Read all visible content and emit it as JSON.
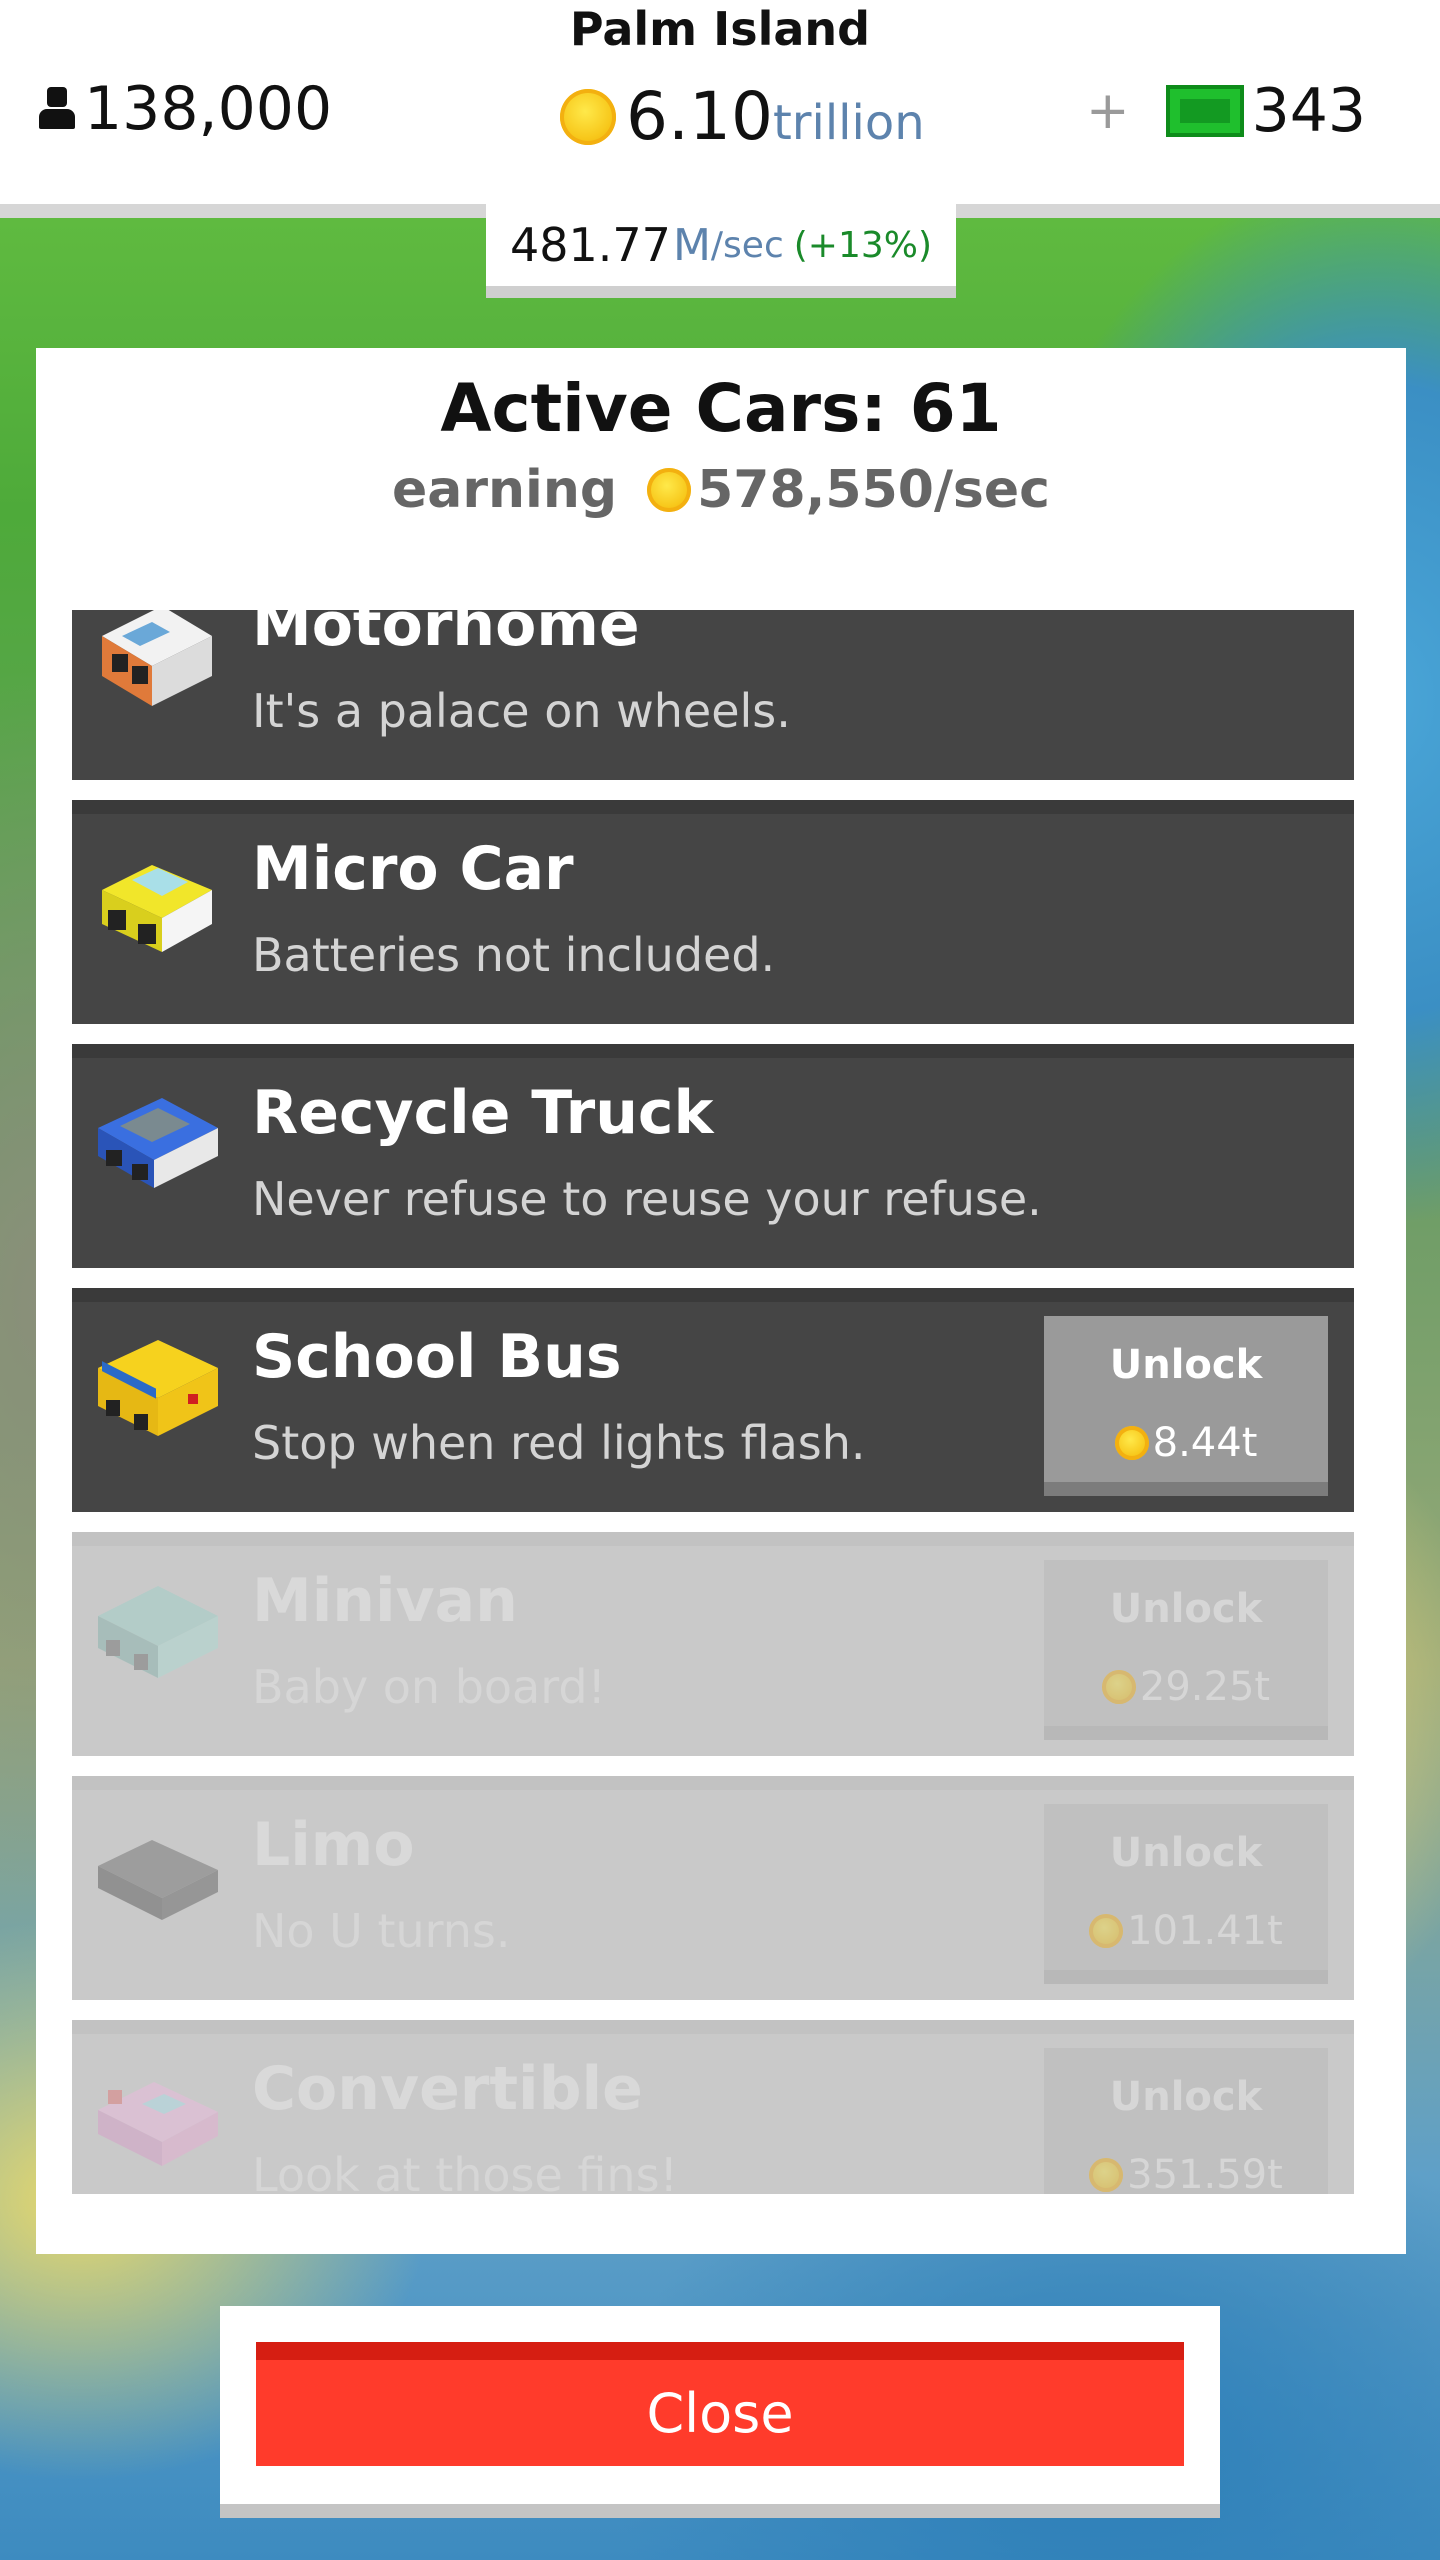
{
  "header": {
    "island_name": "Palm Island",
    "population": "138,000",
    "coins_value": "6.10",
    "coins_unit": "trillion",
    "cash_value": "343",
    "rate_value": "481.77",
    "rate_unit_m": "M",
    "rate_unit_sec": "/sec",
    "rate_bonus": "(+13%)",
    "plus_symbol": "+"
  },
  "panel": {
    "title": "Active Cars: 61",
    "earning_label": "earning",
    "earning_value": "578,550/sec"
  },
  "cars": [
    {
      "name": "Motorhome",
      "desc": "It's a palace on wheels.",
      "locked": false,
      "unlockable": false
    },
    {
      "name": "Micro Car",
      "desc": "Batteries not included.",
      "locked": false,
      "unlockable": false
    },
    {
      "name": "Recycle Truck",
      "desc": "Never refuse to reuse your refuse.",
      "locked": false,
      "unlockable": false
    },
    {
      "name": "School Bus",
      "desc": "Stop when red lights flash.",
      "locked": false,
      "unlockable": true,
      "unlock_label": "Unlock",
      "price": "8.44t"
    },
    {
      "name": "Minivan",
      "desc": "Baby on board!",
      "locked": true,
      "unlockable": true,
      "unlock_label": "Unlock",
      "price": "29.25t"
    },
    {
      "name": "Limo",
      "desc": "No U turns.",
      "locked": true,
      "unlockable": true,
      "unlock_label": "Unlock",
      "price": "101.41t"
    },
    {
      "name": "Convertible",
      "desc": "Look at those fins!",
      "locked": true,
      "unlockable": true,
      "unlock_label": "Unlock",
      "price": "351.59t"
    }
  ],
  "close_label": "Close",
  "colors": {
    "row_bg": "#454545",
    "locked_row_bg": "#c9c9c9",
    "close_button": "#ff3b2b",
    "coin": "#f7c71a",
    "rate_bonus": "#1a8a2a",
    "unit_blue": "#5d83ad"
  },
  "icons": [
    "person-icon",
    "coin-icon",
    "plus-icon",
    "cash-icon"
  ]
}
